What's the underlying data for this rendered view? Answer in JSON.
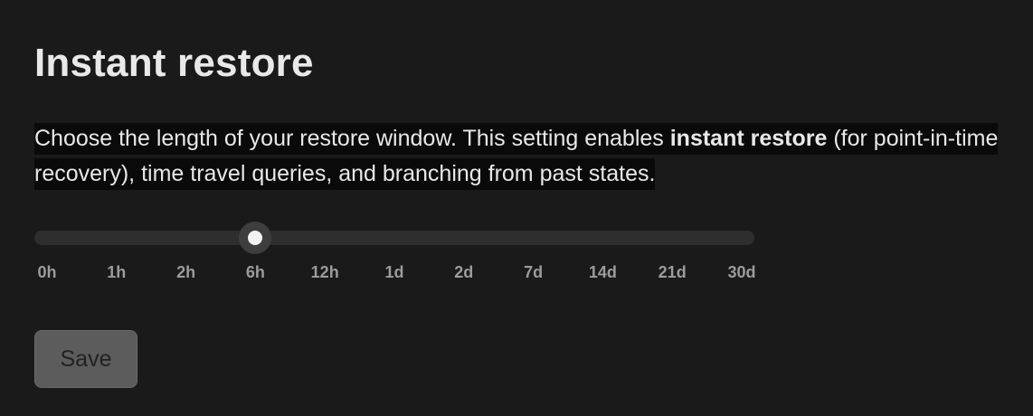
{
  "section": {
    "title": "Instant restore",
    "description": {
      "before": "Choose the length of your restore window. This setting enables ",
      "bold": "instant restore",
      "after": " (for point-in-time recovery), time travel queries, and branching from past states."
    }
  },
  "restore_window": {
    "options": [
      "0h",
      "1h",
      "2h",
      "6h",
      "12h",
      "1d",
      "2d",
      "7d",
      "14d",
      "21d",
      "30d"
    ],
    "selected_index": 3,
    "selected": "6h"
  },
  "actions": {
    "save_label": "Save",
    "save_disabled": true
  }
}
